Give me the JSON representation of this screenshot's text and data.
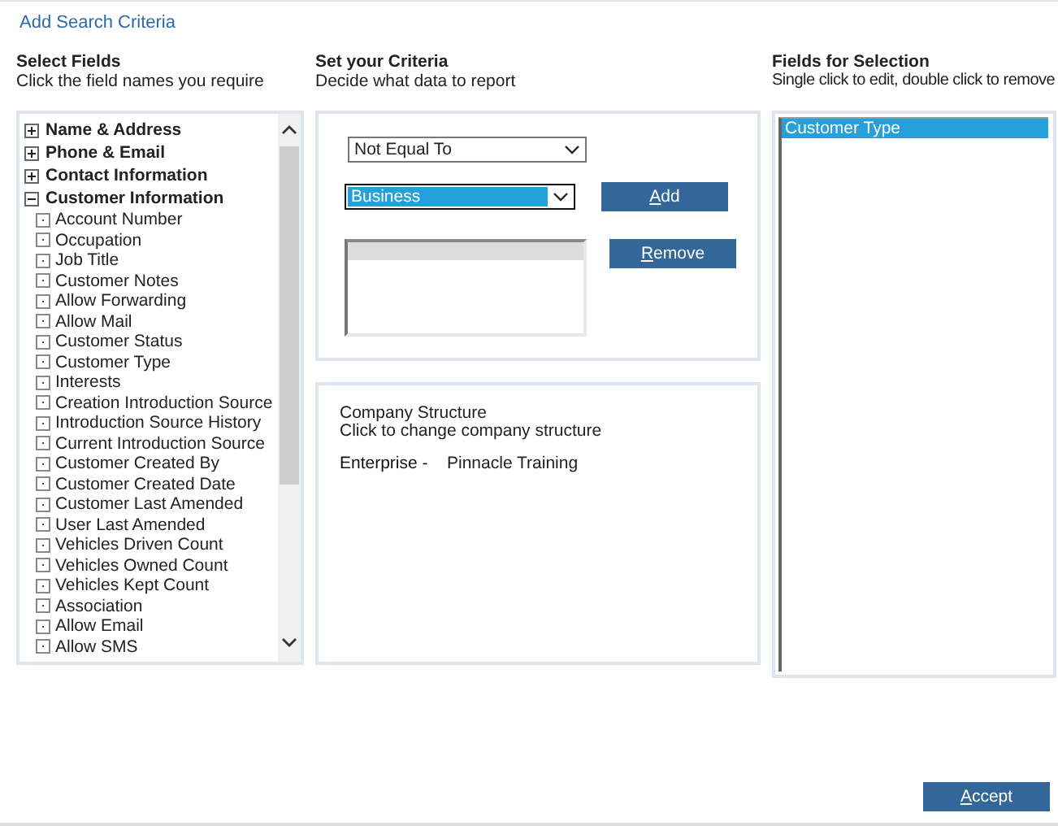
{
  "title": "Add Search Criteria",
  "select_fields": {
    "heading": "Select Fields",
    "hint": "Click the field names you require",
    "groups": [
      {
        "label": "Name & Address",
        "expanded": false
      },
      {
        "label": "Phone & Email",
        "expanded": false
      },
      {
        "label": "Contact Information",
        "expanded": false
      },
      {
        "label": "Customer Information",
        "expanded": true,
        "children": [
          "Account Number",
          "Occupation",
          "Job Title",
          "Customer Notes",
          "Allow Forwarding",
          "Allow Mail",
          "Customer Status",
          "Customer Type",
          "Interests",
          "Creation Introduction Source",
          "Introduction Source History",
          "Current Introduction Source",
          "Customer Created By",
          "Customer Created Date",
          "Customer Last Amended",
          "User Last Amended",
          "Vehicles Driven Count",
          "Vehicles Owned Count",
          "Vehicles Kept Count",
          "Association",
          "Allow Email",
          "Allow SMS"
        ]
      }
    ]
  },
  "criteria": {
    "heading": "Set your Criteria",
    "hint": "Decide what data to report",
    "operator": {
      "value": "Not Equal To",
      "focused": false
    },
    "value": {
      "value": "Business",
      "focused": true
    },
    "buttons": [
      "Add",
      "Remove"
    ]
  },
  "company": {
    "title": "Company Structure",
    "hint": "Click to change company structure",
    "label": "Enterprise -",
    "value": "Pinnacle Training"
  },
  "selection": {
    "heading": "Fields for Selection",
    "hint": "Single click to edit, double click to remove",
    "items": [
      {
        "label": "Customer Type",
        "selected": true
      }
    ]
  },
  "accept_button": "Accept"
}
